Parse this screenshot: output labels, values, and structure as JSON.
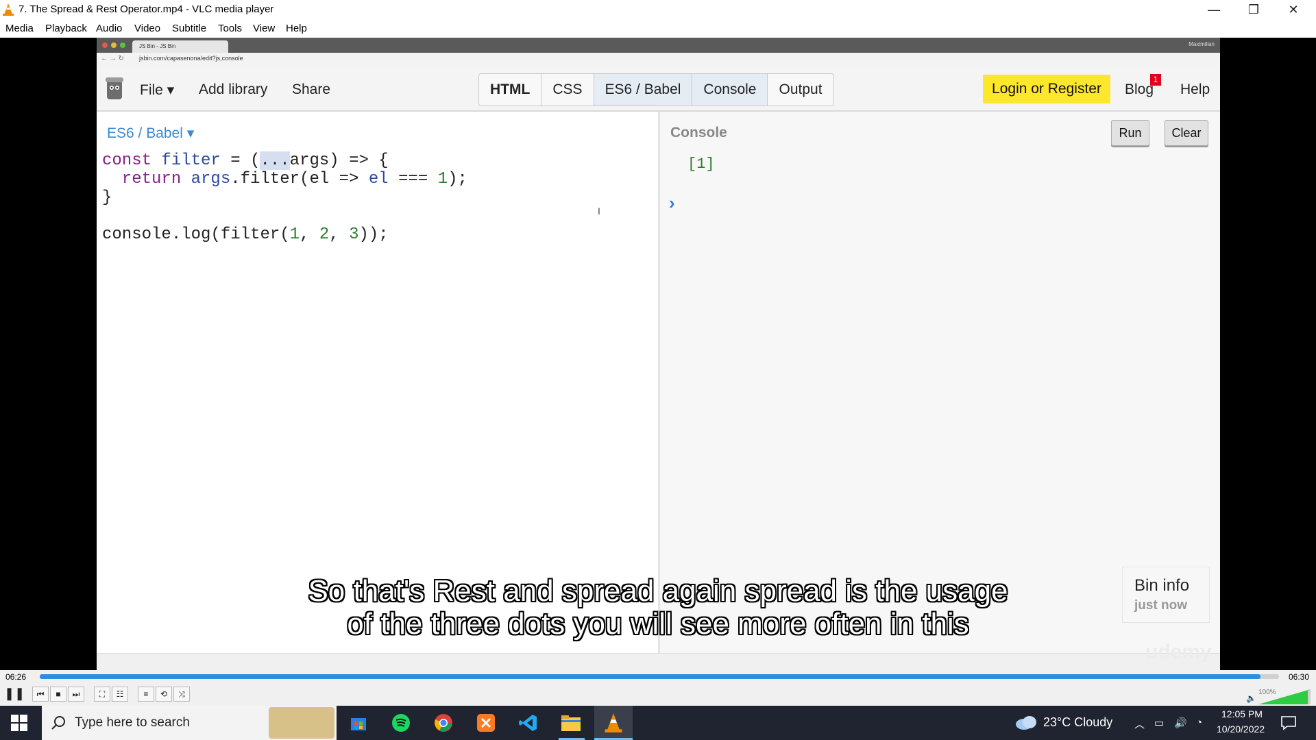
{
  "window": {
    "title": "7. The Spread & Rest Operator.mp4 - VLC media player",
    "controls": [
      "—",
      "❐",
      "✕"
    ]
  },
  "menu": [
    "Media",
    "Playback",
    "Audio",
    "Video",
    "Subtitle",
    "Tools",
    "View",
    "Help"
  ],
  "browser": {
    "tab_title": "JS Bin - JS Bin",
    "user": "Maximilian",
    "url": "jsbin.com/capasenona/edit?js,console"
  },
  "jsbin": {
    "file": "File ▾",
    "add_library": "Add library",
    "share": "Share",
    "panes": [
      "HTML",
      "CSS",
      "ES6 / Babel",
      "Console",
      "Output"
    ],
    "login": "Login or Register",
    "blog": "Blog",
    "blog_badge": "1",
    "help": "Help",
    "language": "ES6 / Babel ▾"
  },
  "code": {
    "line1": {
      "kw": "const",
      "name": " filter",
      "eq": " = (",
      "sel": "...",
      "rest": "args) => {"
    },
    "line2": {
      "indent": "  return ",
      "name": "args",
      "mid": ".filter(el => ",
      "name2": "el",
      "tail": " === ",
      "num": "1",
      "end": ");"
    },
    "line3": "}",
    "line5": {
      "pre": "console.log(filter(",
      "n1": "1",
      "c1": ", ",
      "n2": "2",
      "c2": ", ",
      "n3": "3",
      "end": "));"
    }
  },
  "console": {
    "title": "Console",
    "run": "Run",
    "clear": "Clear",
    "output": "[1]",
    "prompt": "›"
  },
  "bin_info": {
    "title": "Bin info",
    "subtitle": "just now"
  },
  "watermark": "udemy",
  "subtitles": [
    "So that's Rest and spread again spread is the usage",
    "of the three dots you will see more often in this"
  ],
  "player": {
    "current_time": "06:26",
    "total_time": "06:30",
    "progress": 0.985,
    "volume": "100%"
  },
  "taskbar": {
    "search_placeholder": "Type here to search",
    "weather": "23°C  Cloudy",
    "time": "12:05 PM",
    "date": "10/20/2022"
  }
}
